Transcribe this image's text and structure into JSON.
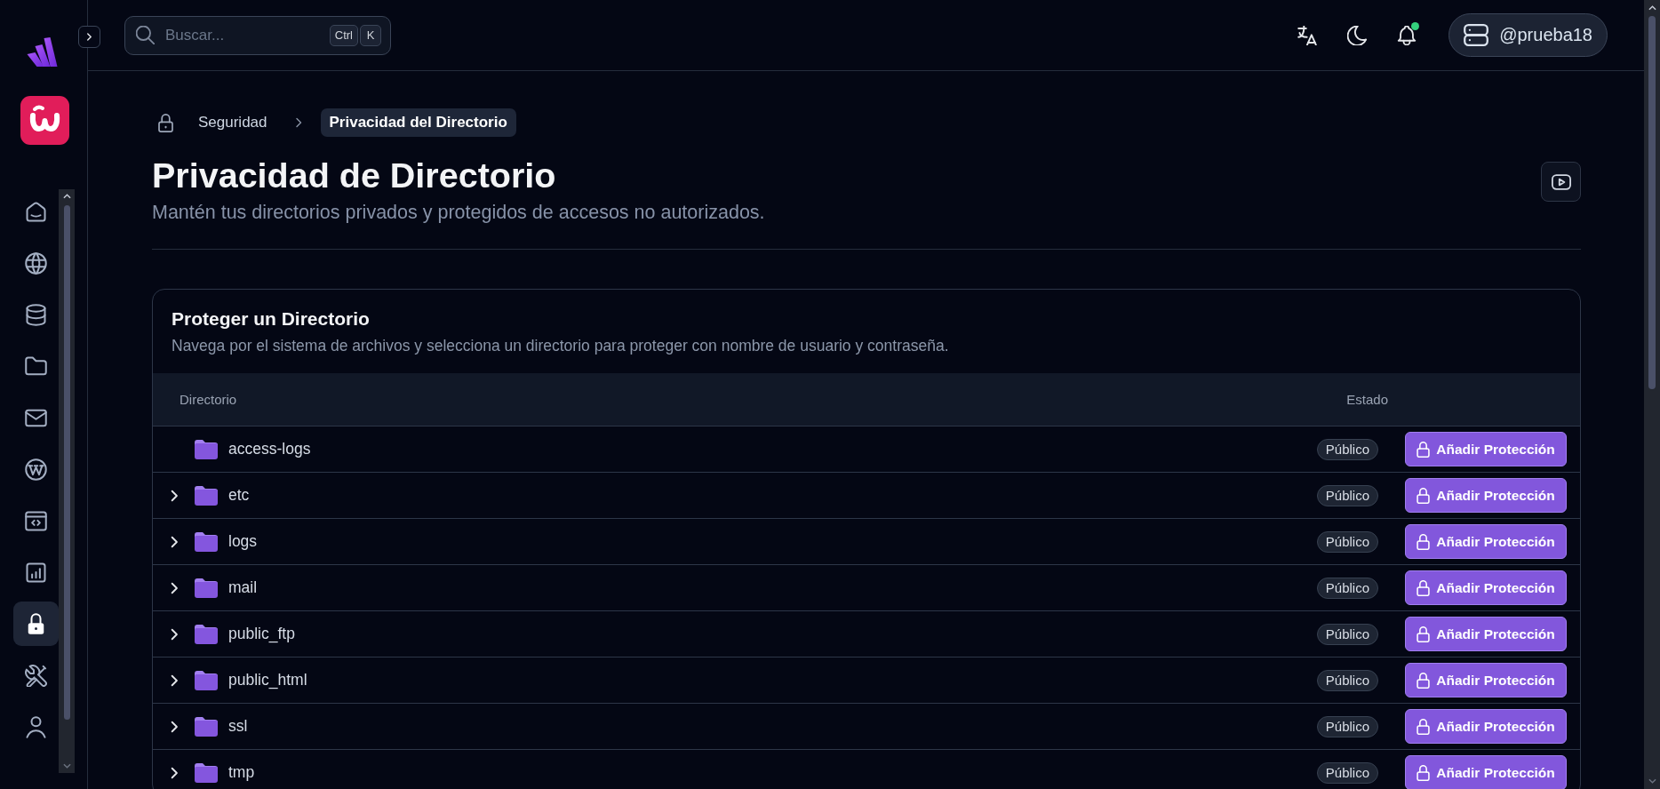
{
  "sidebar": {
    "nav_items": [
      {
        "selected": false
      },
      {
        "selected": false
      },
      {
        "selected": false
      },
      {
        "selected": false
      },
      {
        "selected": false
      },
      {
        "selected": false
      },
      {
        "selected": false
      },
      {
        "selected": false
      },
      {
        "selected": true
      },
      {
        "selected": false
      },
      {
        "selected": false
      }
    ]
  },
  "header": {
    "search": {
      "placeholder": "Buscar...",
      "shortcut_keys": [
        "Ctrl",
        "K"
      ]
    },
    "notifications": {
      "unread": true
    },
    "account": {
      "label": "@prueba18"
    }
  },
  "breadcrumb": [
    {
      "label": "Seguridad",
      "selected": false
    },
    {
      "label": "Privacidad del Directorio",
      "selected": true
    }
  ],
  "page": {
    "title": "Privacidad de Directorio",
    "subtitle": "Mantén tus directorios privados y protegidos de accesos no autorizados."
  },
  "card": {
    "title": "Proteger un Directorio",
    "subtitle": "Navega por el sistema de archivos y selecciona un directorio para proteger con nombre de usuario y contraseña.",
    "columns": [
      "Directorio",
      "Estado"
    ],
    "rows": [
      {
        "name": "access-logs",
        "expandable": false,
        "status": "Público",
        "action": "Añadir Protección"
      },
      {
        "name": "etc",
        "expandable": true,
        "status": "Público",
        "action": "Añadir Protección"
      },
      {
        "name": "logs",
        "expandable": true,
        "status": "Público",
        "action": "Añadir Protección"
      },
      {
        "name": "mail",
        "expandable": true,
        "status": "Público",
        "action": "Añadir Protección"
      },
      {
        "name": "public_ftp",
        "expandable": true,
        "status": "Público",
        "action": "Añadir Protección"
      },
      {
        "name": "public_html",
        "expandable": true,
        "status": "Público",
        "action": "Añadir Protección"
      },
      {
        "name": "ssl",
        "expandable": true,
        "status": "Público",
        "action": "Añadir Protección"
      },
      {
        "name": "tmp",
        "expandable": true,
        "status": "Público",
        "action": "Añadir Protección"
      }
    ]
  }
}
